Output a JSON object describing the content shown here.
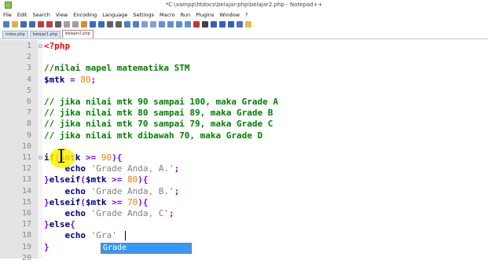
{
  "window": {
    "title": "*C:\\xampp\\htdocs\\belajar-php\\belajar2.php - Notepad++"
  },
  "menu": [
    "File",
    "Edit",
    "Search",
    "View",
    "Encoding",
    "Language",
    "Settings",
    "Macro",
    "Run",
    "Plugins",
    "Window",
    "?"
  ],
  "tabs": [
    {
      "label": "index.php",
      "active": false
    },
    {
      "label": "belajar1.php",
      "active": false
    },
    {
      "label": "belajar2.php",
      "active": true
    }
  ],
  "autocomplete": {
    "items": [
      "Grade"
    ],
    "selected": "Grade"
  },
  "lines": [
    {
      "n": "1",
      "fold": "⊟",
      "tokens": [
        {
          "c": "tag",
          "t": "<?php"
        }
      ]
    },
    {
      "n": "2",
      "fold": "",
      "tokens": []
    },
    {
      "n": "3",
      "fold": "",
      "tokens": [
        {
          "c": "cm",
          "t": "//nilai mapel matematika STM"
        }
      ]
    },
    {
      "n": "4",
      "fold": "",
      "tokens": [
        {
          "c": "vr",
          "t": "$mtk"
        },
        {
          "c": "",
          "t": " "
        },
        {
          "c": "op",
          "t": "="
        },
        {
          "c": "",
          "t": " "
        },
        {
          "c": "nm",
          "t": "80"
        },
        {
          "c": "op",
          "t": ";"
        }
      ]
    },
    {
      "n": "5",
      "fold": "",
      "tokens": []
    },
    {
      "n": "6",
      "fold": "",
      "tokens": [
        {
          "c": "cm",
          "t": "// jika nilai mtk 90 sampai 100, maka Grade A"
        }
      ]
    },
    {
      "n": "7",
      "fold": "",
      "tokens": [
        {
          "c": "cm",
          "t": "// jika nilai mtk 80 sampai 89, maka Grade B"
        }
      ]
    },
    {
      "n": "8",
      "fold": "",
      "tokens": [
        {
          "c": "cm",
          "t": "// jika nilai mtk 70 sampai 79, maka Grade C"
        }
      ]
    },
    {
      "n": "9",
      "fold": "",
      "tokens": [
        {
          "c": "cm",
          "t": "// jika nilai mtk dibawah 70, maka Grade D"
        }
      ]
    },
    {
      "n": "10",
      "fold": "",
      "tokens": []
    },
    {
      "n": "11",
      "fold": "⊟",
      "tokens": [
        {
          "c": "kw",
          "t": "if"
        },
        {
          "c": "op",
          "t": "("
        },
        {
          "c": "vr",
          "t": "$mtk"
        },
        {
          "c": "",
          "t": " "
        },
        {
          "c": "op",
          "t": ">="
        },
        {
          "c": "",
          "t": " "
        },
        {
          "c": "nm",
          "t": "90"
        },
        {
          "c": "op",
          "t": "){"
        }
      ]
    },
    {
      "n": "12",
      "fold": "",
      "tokens": [
        {
          "c": "",
          "t": "    "
        },
        {
          "c": "kw",
          "t": "echo"
        },
        {
          "c": "",
          "t": " "
        },
        {
          "c": "str",
          "t": "'Grade Anda, A.'"
        },
        {
          "c": "op",
          "t": ";"
        }
      ]
    },
    {
      "n": "13",
      "fold": "",
      "tokens": [
        {
          "c": "op",
          "t": "}"
        },
        {
          "c": "kw",
          "t": "elseif"
        },
        {
          "c": "op",
          "t": "("
        },
        {
          "c": "vr",
          "t": "$mtk"
        },
        {
          "c": "",
          "t": " "
        },
        {
          "c": "op",
          "t": ">="
        },
        {
          "c": "",
          "t": " "
        },
        {
          "c": "nm",
          "t": "80"
        },
        {
          "c": "op",
          "t": "){"
        }
      ]
    },
    {
      "n": "14",
      "fold": "",
      "tokens": [
        {
          "c": "",
          "t": "    "
        },
        {
          "c": "kw",
          "t": "echo"
        },
        {
          "c": "",
          "t": " "
        },
        {
          "c": "str",
          "t": "'Grade Anda, B.'"
        },
        {
          "c": "op",
          "t": ";"
        }
      ]
    },
    {
      "n": "15",
      "fold": "",
      "tokens": [
        {
          "c": "op",
          "t": "}"
        },
        {
          "c": "kw",
          "t": "elseif"
        },
        {
          "c": "op",
          "t": "("
        },
        {
          "c": "vr",
          "t": "$mtk"
        },
        {
          "c": "",
          "t": " "
        },
        {
          "c": "op",
          "t": ">="
        },
        {
          "c": "",
          "t": " "
        },
        {
          "c": "nm",
          "t": "70"
        },
        {
          "c": "op",
          "t": "){"
        }
      ]
    },
    {
      "n": "16",
      "fold": "",
      "tokens": [
        {
          "c": "",
          "t": "    "
        },
        {
          "c": "kw",
          "t": "echo"
        },
        {
          "c": "",
          "t": " "
        },
        {
          "c": "str",
          "t": "'Grade Anda, C'"
        },
        {
          "c": "op",
          "t": ";"
        }
      ]
    },
    {
      "n": "17",
      "fold": "",
      "tokens": [
        {
          "c": "op",
          "t": "}"
        },
        {
          "c": "kw",
          "t": "else"
        },
        {
          "c": "op",
          "t": "{"
        }
      ]
    },
    {
      "n": "18",
      "fold": "",
      "tokens": [
        {
          "c": "",
          "t": "    "
        },
        {
          "c": "kw",
          "t": "echo"
        },
        {
          "c": "",
          "t": " "
        },
        {
          "c": "str",
          "t": "'Gra'"
        }
      ]
    },
    {
      "n": "19",
      "fold": "",
      "tokens": [
        {
          "c": "op",
          "t": "}"
        }
      ]
    },
    {
      "n": "20",
      "fold": "",
      "tokens": []
    }
  ]
}
